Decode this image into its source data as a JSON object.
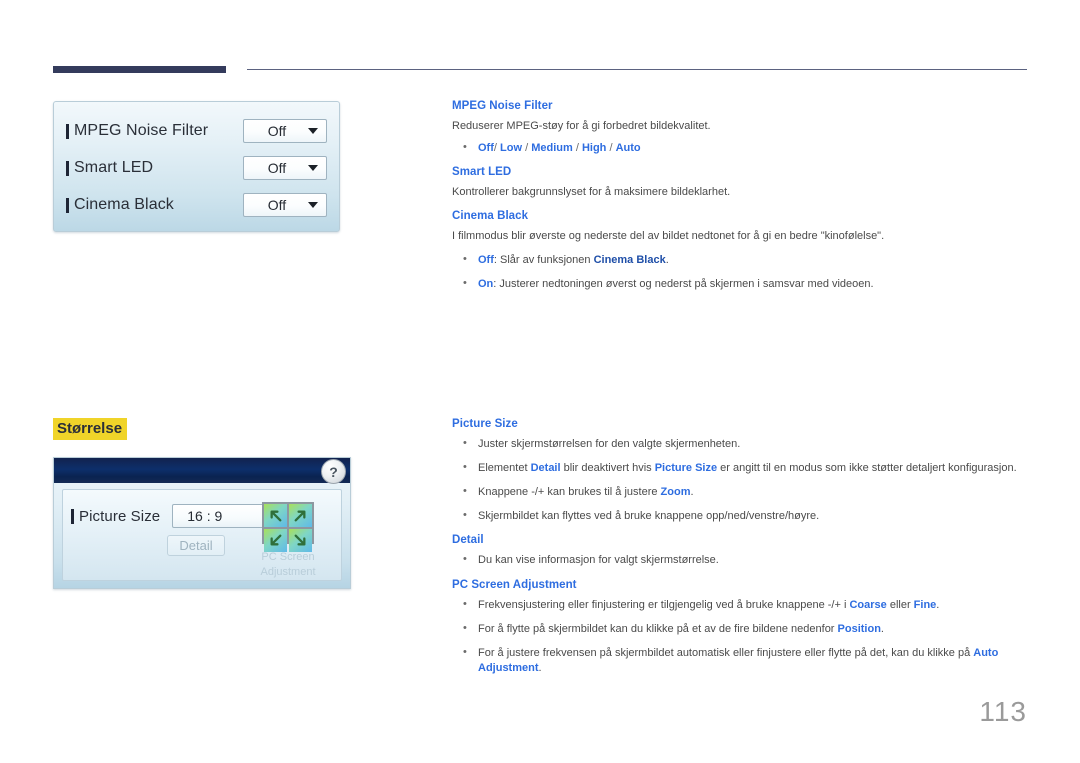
{
  "page": {
    "number": "113"
  },
  "osd_noise_panel": {
    "name": "picture-options-osd",
    "rows": [
      {
        "label": "MPEG Noise Filter",
        "value": "Off"
      },
      {
        "label": "Smart LED",
        "value": "Off"
      },
      {
        "label": "Cinema Black",
        "value": "Off"
      }
    ]
  },
  "section": {
    "heading": "Størrelse"
  },
  "osd_size_panel": {
    "help_icon": "?",
    "picture_size_label": "Picture Size",
    "picture_size_value": "16 : 9",
    "detail_button": "Detail",
    "pc_screen_adjustment_label": "PC Screen Adjustment"
  },
  "doc_top": {
    "mpeg": {
      "heading": "MPEG Noise Filter",
      "paragraph": "Reduserer MPEG-støy for å gi forbedret bildekvalitet.",
      "options": [
        "Off",
        "Low",
        "Medium",
        "High",
        "Auto"
      ],
      "separator": "/"
    },
    "smart_led": {
      "heading": "Smart LED",
      "paragraph": "Kontrollerer bakgrunnslyset for å maksimere bildeklarhet."
    },
    "cinema_black": {
      "heading": "Cinema Black",
      "paragraph": "I filmmodus blir øverste og nederste del av bildet nedtonet for å gi en bedre \"kinofølelse\".",
      "bullet_off_key": "Off",
      "bullet_off_text_a": ": Slår av funksjonen ",
      "bullet_off_text_b": "Cinema Black",
      "bullet_off_text_c": ".",
      "bullet_on_key": "On",
      "bullet_on_text": ": Justerer nedtoningen øverst og nederst på skjermen i samsvar med videoen."
    }
  },
  "doc_bottom": {
    "picture_size": {
      "heading": "Picture Size",
      "b1": "Juster skjermstørrelsen for den valgte skjermenheten.",
      "b2_a": "Elementet ",
      "b2_detail": "Detail",
      "b2_b": " blir deaktivert hvis ",
      "b2_picturesize": "Picture Size",
      "b2_c": " er angitt til en modus som ikke støtter detaljert konfigurasjon.",
      "b3_a": "Knappene -/+ kan brukes til å justere ",
      "b3_zoom": "Zoom",
      "b3_b": ".",
      "b4": "Skjermbildet kan flyttes ved å bruke knappene opp/ned/venstre/høyre."
    },
    "detail": {
      "heading": "Detail",
      "b1": "Du kan vise informasjon for valgt skjermstørrelse."
    },
    "pc_screen_adjustment": {
      "heading": "PC Screen Adjustment",
      "b1_a": "Frekvensjustering eller finjustering er tilgjengelig ved å bruke knappene -/+ i ",
      "b1_coarse": "Coarse",
      "b1_b": " eller ",
      "b1_fine": "Fine",
      "b1_c": ".",
      "b2_a": "For å flytte på skjermbildet kan du klikke på et av de fire bildene nedenfor ",
      "b2_position": "Position",
      "b2_b": ".",
      "b3_a": "For å justere frekvensen på skjermbildet automatisk eller finjustere eller flytte på det, kan du klikke på ",
      "b3_auto": "Auto Adjustment",
      "b3_b": "."
    }
  },
  "colors": {
    "accent_blue": "#2E6DE0",
    "deep_blue": "#1f4fa8",
    "rule_navy": "#343B5C",
    "highlight_yellow": "#f0d429",
    "body_text": "#4a4a4a"
  }
}
